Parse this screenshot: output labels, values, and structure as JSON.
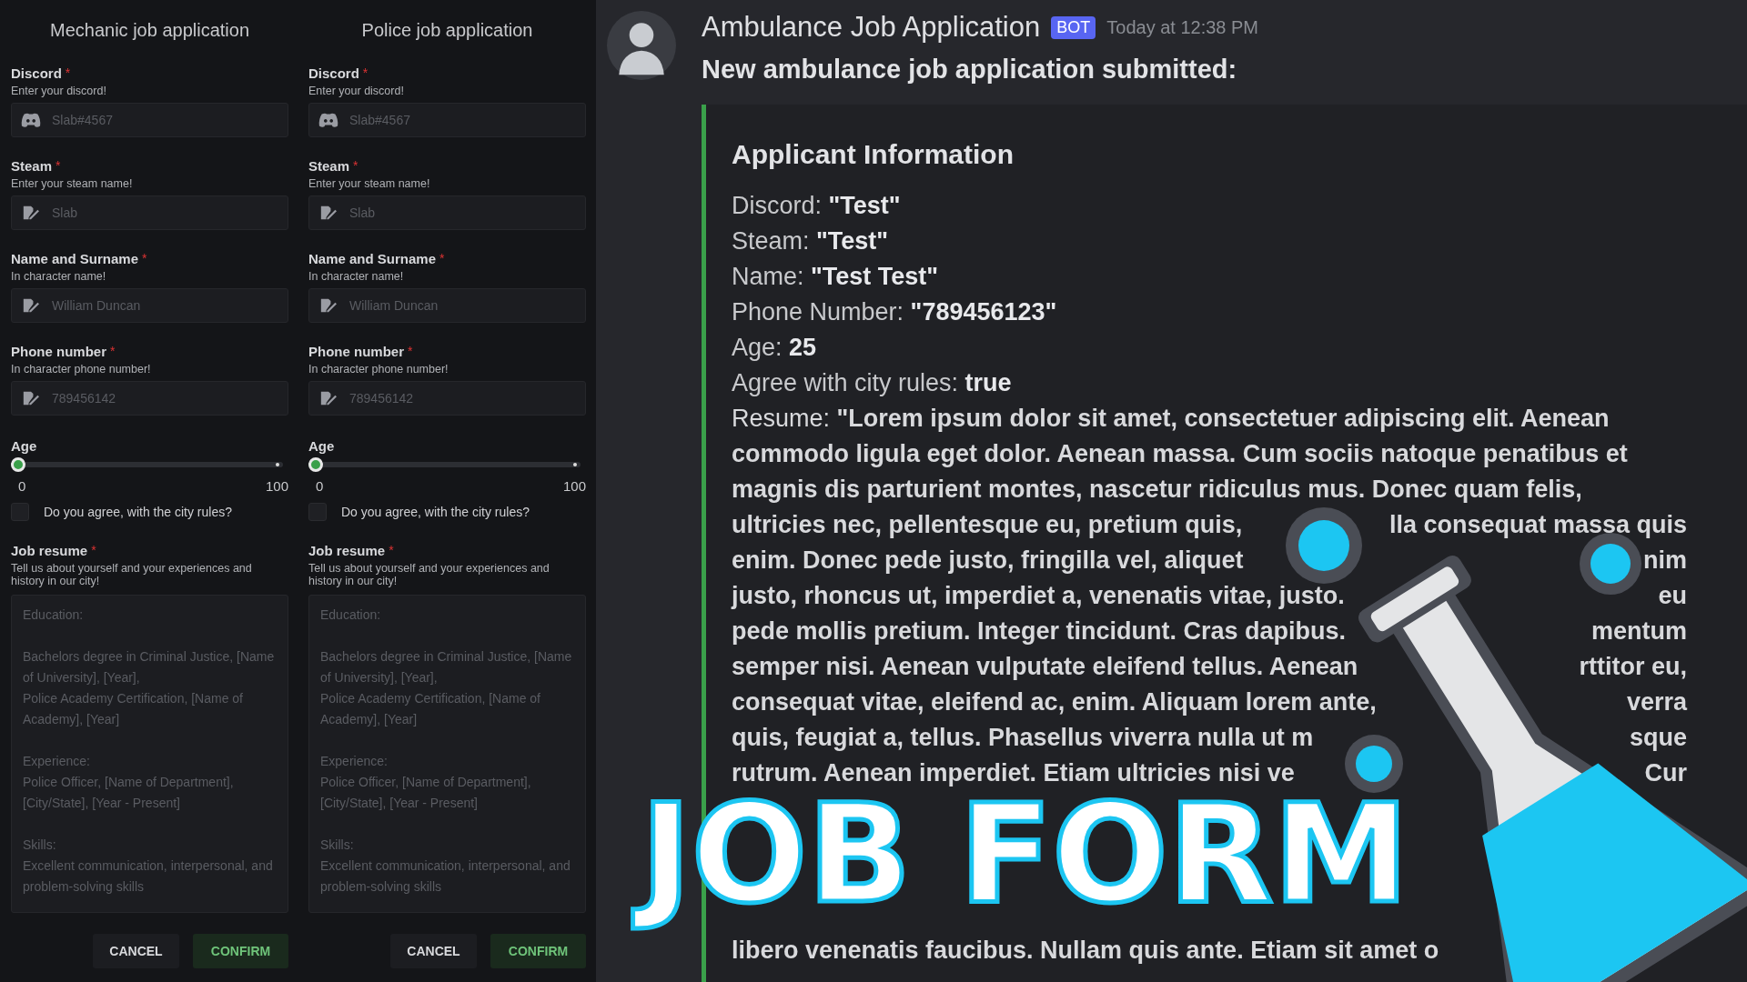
{
  "forms": [
    {
      "title": "Mechanic job application",
      "fields": [
        {
          "label": "Discord",
          "required_mark": "*",
          "hint": "Enter your discord!",
          "placeholder": "Slab#4567",
          "kind": "discord"
        },
        {
          "label": "Steam",
          "required_mark": "*",
          "hint": "Enter your steam name!",
          "placeholder": "Slab",
          "kind": "edit"
        },
        {
          "label": "Name and Surname",
          "required_mark": "*",
          "hint": "In character name!",
          "placeholder": "William Duncan",
          "kind": "edit"
        },
        {
          "label": "Phone number",
          "required_mark": "*",
          "hint": "In character phone number!",
          "placeholder": "789456142",
          "kind": "edit"
        }
      ],
      "age": {
        "label": "Age",
        "level": 0,
        "min": "0",
        "max": "100"
      },
      "agree": {
        "label": "Do you agree, with the city rules?",
        "checked": false
      },
      "resume": {
        "label": "Job resume",
        "required_mark": "*",
        "hint": "Tell us about yourself and your experiences and history in our city!",
        "placeholder": "Education:\n\nBachelors degree in Criminal Justice, [Name of University], [Year],\nPolice Academy Certification, [Name of Academy], [Year]\n\nExperience:\nPolice Officer, [Name of Department], [City/State], [Year - Present]\n\nSkills:\nExcellent communication, interpersonal, and problem-solving skills"
      },
      "buttons": [
        {
          "label": "CANCEL",
          "kind": "cancel"
        },
        {
          "label": "CONFIRM",
          "kind": "confirm"
        }
      ]
    },
    {
      "title": "Police job application",
      "fields": [
        {
          "label": "Discord",
          "required_mark": "*",
          "hint": "Enter your discord!",
          "placeholder": "Slab#4567",
          "kind": "discord"
        },
        {
          "label": "Steam",
          "required_mark": "*",
          "hint": "Enter your steam name!",
          "placeholder": "Slab",
          "kind": "edit"
        },
        {
          "label": "Name and Surname",
          "required_mark": "*",
          "hint": "In character name!",
          "placeholder": "William Duncan",
          "kind": "edit"
        },
        {
          "label": "Phone number",
          "required_mark": "*",
          "hint": "In character phone number!",
          "placeholder": "789456142",
          "kind": "edit"
        }
      ],
      "age": {
        "label": "Age",
        "level": 0,
        "min": "0",
        "max": "100"
      },
      "agree": {
        "label": "Do you agree, with the city rules?",
        "checked": false
      },
      "resume": {
        "label": "Job resume",
        "required_mark": "*",
        "hint": "Tell us about yourself and your experiences and history in our city!",
        "placeholder": "Education:\n\nBachelors degree in Criminal Justice, [Name of University], [Year],\nPolice Academy Certification, [Name of Academy], [Year]\n\nExperience:\nPolice Officer, [Name of Department], [City/State], [Year - Present]\n\nSkills:\nExcellent communication, interpersonal, and problem-solving skills"
      },
      "buttons": [
        {
          "label": "CANCEL",
          "kind": "cancel"
        },
        {
          "label": "CONFIRM",
          "kind": "confirm"
        }
      ]
    }
  ],
  "message": {
    "author": "Ambulance Job Application",
    "badge": "BOT",
    "time": "Today at 12:38 PM",
    "content": "New ambulance job application submitted:",
    "embed": {
      "title": "Applicant Information",
      "fields": [
        {
          "label": "Discord:",
          "value": "\"Test\""
        },
        {
          "label": "Steam:",
          "value": "\"Test\""
        },
        {
          "label": "Name:",
          "value": "\"Test Test\""
        },
        {
          "label": "Phone Number:",
          "value": "\"789456123\""
        },
        {
          "label": "Age:",
          "value": "25"
        },
        {
          "label": "Agree with city rules:",
          "value": "true"
        }
      ],
      "resume_lines": [
        [
          "Resume: **\"Lorem ipsum dolor sit amet, consectetuer adipiscing elit. Aenean**"
        ],
        [
          "commodo ligula eget dolor. Aenean massa. Cum sociis natoque penatibus et"
        ],
        [
          "magnis dis parturient montes, nascetur ridiculus mus. Donec quam felis,"
        ],
        [
          "ultricies nec, pellentesque eu, pretium quis,",
          "lla consequat massa quis"
        ],
        [
          "enim. Donec pede justo, fringilla vel, aliquet",
          "nim"
        ],
        [
          "justo, rhoncus ut, imperdiet a, venenatis vitae, justo.",
          "eu"
        ],
        [
          "pede mollis pretium. Integer tincidunt. Cras dapibus.",
          "mentum"
        ],
        [
          "semper nisi. Aenean vulputate eleifend tellus. Aenean",
          "rttitor eu,"
        ],
        [
          "consequat vitae, eleifend ac, enim. Aliquam lorem ante,",
          "verra"
        ],
        [
          "quis, feugiat a, tellus. Phasellus viverra nulla ut m",
          "sque"
        ],
        [
          "rutrum. Aenean imperdiet. Etiam ultricies nisi ve",
          "Cur"
        ]
      ],
      "resume_tail": "libero venenatis faucibus. Nullam quis ante. Etiam sit amet o"
    }
  },
  "overlay": {
    "title": "JOB FORM"
  }
}
